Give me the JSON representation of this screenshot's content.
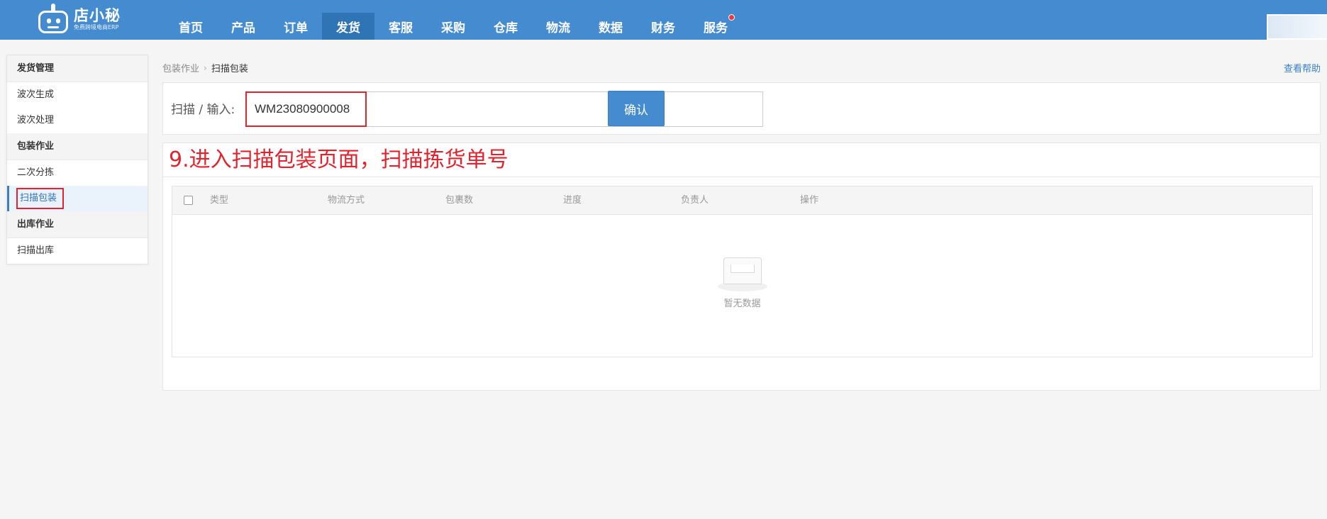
{
  "brand": {
    "name": "店小秘",
    "tagline": "免费跨境电商ERP"
  },
  "nav": {
    "items": [
      {
        "label": "首页",
        "active": false
      },
      {
        "label": "产品",
        "active": false
      },
      {
        "label": "订单",
        "active": false
      },
      {
        "label": "发货",
        "active": true
      },
      {
        "label": "客服",
        "active": false
      },
      {
        "label": "采购",
        "active": false
      },
      {
        "label": "仓库",
        "active": false
      },
      {
        "label": "物流",
        "active": false
      },
      {
        "label": "数据",
        "active": false
      },
      {
        "label": "财务",
        "active": false
      },
      {
        "label": "服务",
        "active": false,
        "notification_dot": true
      }
    ]
  },
  "sidebar": {
    "groups": [
      {
        "title": "发货管理",
        "items": [
          "波次生成",
          "波次处理"
        ]
      },
      {
        "title": "包装作业",
        "items": [
          "二次分拣",
          "扫描包装"
        ],
        "active_item": "扫描包装"
      },
      {
        "title": "出库作业",
        "items": [
          "扫描出库"
        ]
      }
    ]
  },
  "breadcrumb": {
    "parent": "包装作业",
    "current": "扫描包装"
  },
  "help_link": "查看帮助",
  "scan": {
    "label": "扫描 / 输入:",
    "value": "WM23080900008",
    "confirm_label": "确认"
  },
  "annotation": "9.进入扫描包装页面，扫描拣货单号",
  "table": {
    "columns": [
      "类型",
      "物流方式",
      "包裹数",
      "进度",
      "负责人",
      "操作"
    ],
    "empty_text": "暂无数据"
  },
  "colors": {
    "nav_bg": "#448bcf",
    "nav_active": "#2f74b5",
    "highlight": "#e0232d",
    "link": "#3a7fc4"
  }
}
